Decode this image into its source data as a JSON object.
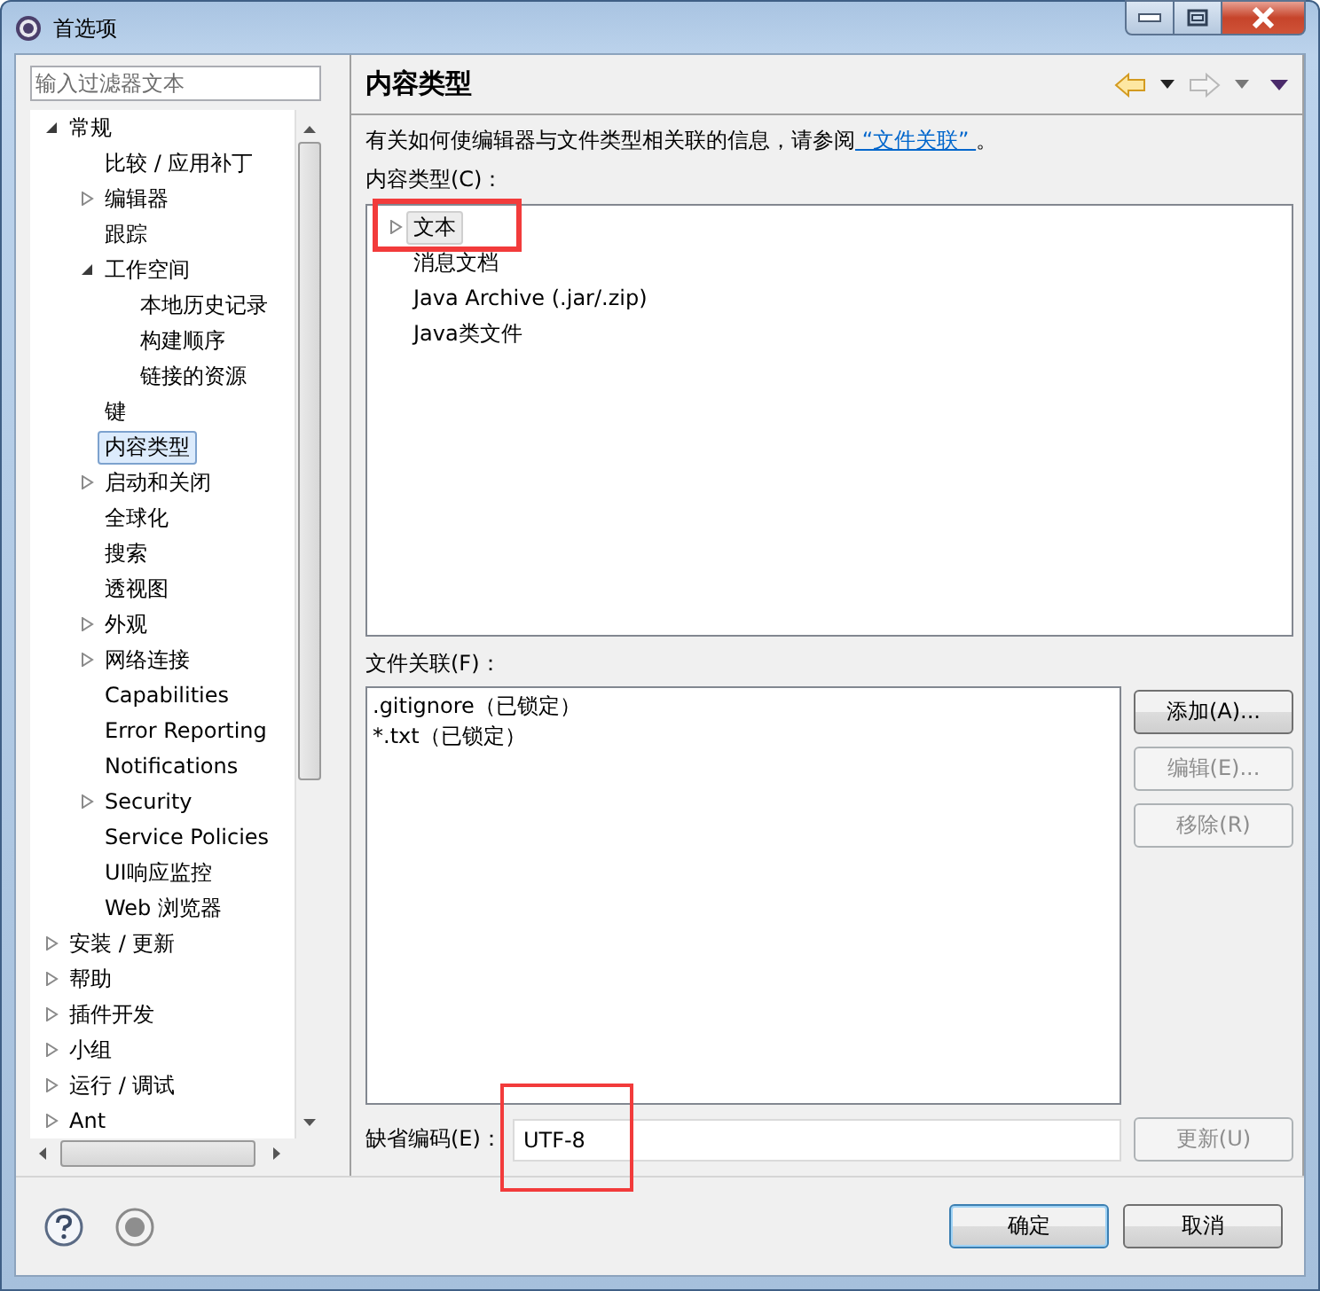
{
  "window": {
    "title": "首选项"
  },
  "filter": {
    "placeholder": "输入过滤器文本"
  },
  "tree": [
    {
      "label": "常规",
      "expanded": true,
      "selected": false,
      "children": [
        {
          "label": "比较 / 应用补丁",
          "selected": false
        },
        {
          "label": "编辑器",
          "expanded": false,
          "selected": false
        },
        {
          "label": "跟踪",
          "selected": false
        },
        {
          "label": "工作空间",
          "expanded": true,
          "selected": false,
          "children": [
            {
              "label": "本地历史记录",
              "selected": false
            },
            {
              "label": "构建顺序",
              "selected": false
            },
            {
              "label": "链接的资源",
              "selected": false
            }
          ]
        },
        {
          "label": "键",
          "selected": false
        },
        {
          "label": "内容类型",
          "selected": true
        },
        {
          "label": "启动和关闭",
          "expanded": false,
          "selected": false
        },
        {
          "label": "全球化",
          "selected": false
        },
        {
          "label": "搜索",
          "selected": false
        },
        {
          "label": "透视图",
          "selected": false
        },
        {
          "label": "外观",
          "expanded": false,
          "selected": false
        },
        {
          "label": "网络连接",
          "expanded": false,
          "selected": false
        },
        {
          "label": "Capabilities",
          "selected": false
        },
        {
          "label": "Error Reporting",
          "selected": false
        },
        {
          "label": "Notifications",
          "selected": false
        },
        {
          "label": "Security",
          "expanded": false,
          "selected": false
        },
        {
          "label": "Service Policies",
          "selected": false
        },
        {
          "label": "UI响应监控",
          "selected": false
        },
        {
          "label": "Web 浏览器",
          "selected": false
        }
      ]
    },
    {
      "label": "安装 / 更新",
      "expanded": false,
      "selected": false
    },
    {
      "label": "帮助",
      "expanded": false,
      "selected": false
    },
    {
      "label": "插件开发",
      "expanded": false,
      "selected": false
    },
    {
      "label": "小组",
      "expanded": false,
      "selected": false
    },
    {
      "label": "运行 / 调试",
      "expanded": false,
      "selected": false
    },
    {
      "label": "Ant",
      "expanded": false,
      "selected": false
    }
  ],
  "page": {
    "title": "内容类型",
    "navigation": {
      "back_enabled": true,
      "forward_enabled": false
    },
    "description": "有关如何使编辑器与文件类型相关联的信息，请参阅",
    "link": " “文件关联” ",
    "description_end": "。",
    "content_types_label": "内容类型(C)：",
    "content_types": [
      {
        "label": "文本",
        "expanded": false,
        "selected": true,
        "highlighted": true
      },
      {
        "label": "消息文档",
        "selected": false,
        "highlighted": false
      },
      {
        "label": "Java Archive (.jar/.zip)",
        "selected": false,
        "highlighted": false
      },
      {
        "label": "Java类文件",
        "selected": false,
        "highlighted": false
      }
    ],
    "file_associations_label": "文件关联(F)：",
    "file_associations": [
      ".gitignore（已锁定）",
      "*.txt（已锁定）"
    ],
    "association_buttons": [
      {
        "label": "添加(A)...",
        "disabled": false
      },
      {
        "label": "编辑(E)...",
        "disabled": true
      },
      {
        "label": "移除(R)",
        "disabled": true
      }
    ],
    "encoding": {
      "label": "缺省编码(E)：",
      "value": "UTF-8",
      "highlighted": true,
      "button": {
        "label": "更新(U)",
        "disabled": true
      }
    }
  },
  "footer": {
    "buttons": [
      {
        "label": "确定",
        "default": true
      },
      {
        "label": "取消",
        "default": false
      }
    ]
  }
}
